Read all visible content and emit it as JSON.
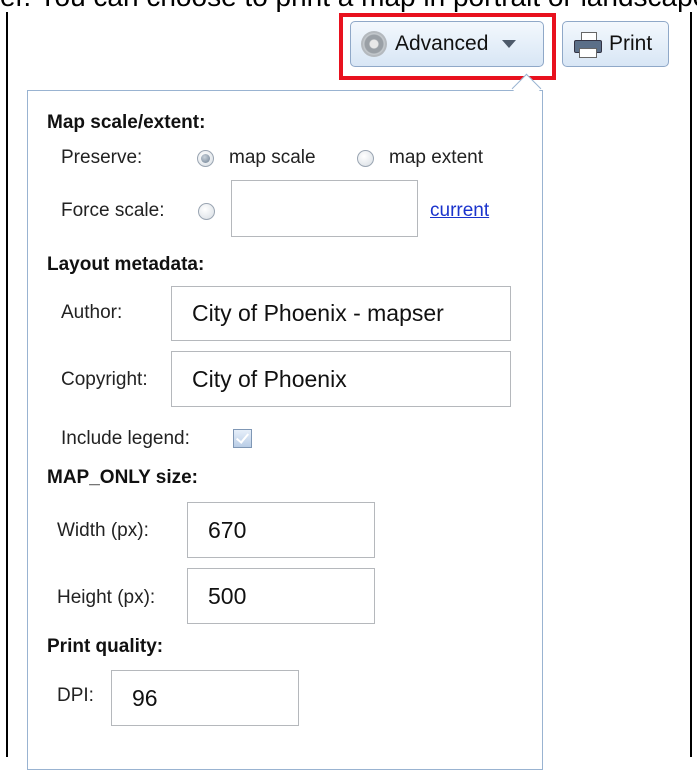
{
  "top_text": "er. You can choose to print a map in portrait or landscape orientation, layout size, etc. Click Print to open the print dialog",
  "toolbar": {
    "advanced_label": "Advanced",
    "print_label": "Print"
  },
  "map_scale": {
    "heading": "Map scale/extent:",
    "preserve_label": "Preserve:",
    "option_scale": "map scale",
    "option_extent": "map extent",
    "selected": "map scale",
    "force_scale_label": "Force scale:",
    "force_scale_value": "",
    "current_link": "current"
  },
  "layout_metadata": {
    "heading": "Layout metadata:",
    "author_label": "Author:",
    "author_value": "City of Phoenix - mapser",
    "copyright_label": "Copyright:",
    "copyright_value": "City of Phoenix",
    "include_legend_label": "Include legend:",
    "include_legend_checked": true
  },
  "map_only": {
    "heading": "MAP_ONLY size:",
    "width_label": "Width (px):",
    "width_value": "670",
    "height_label": "Height (px):",
    "height_value": "500"
  },
  "print_quality": {
    "heading": "Print quality:",
    "dpi_label": "DPI:",
    "dpi_value": "96"
  },
  "colors": {
    "highlight": "#e8111e",
    "link": "#1a33cc",
    "panel_border": "#99b3d1"
  }
}
